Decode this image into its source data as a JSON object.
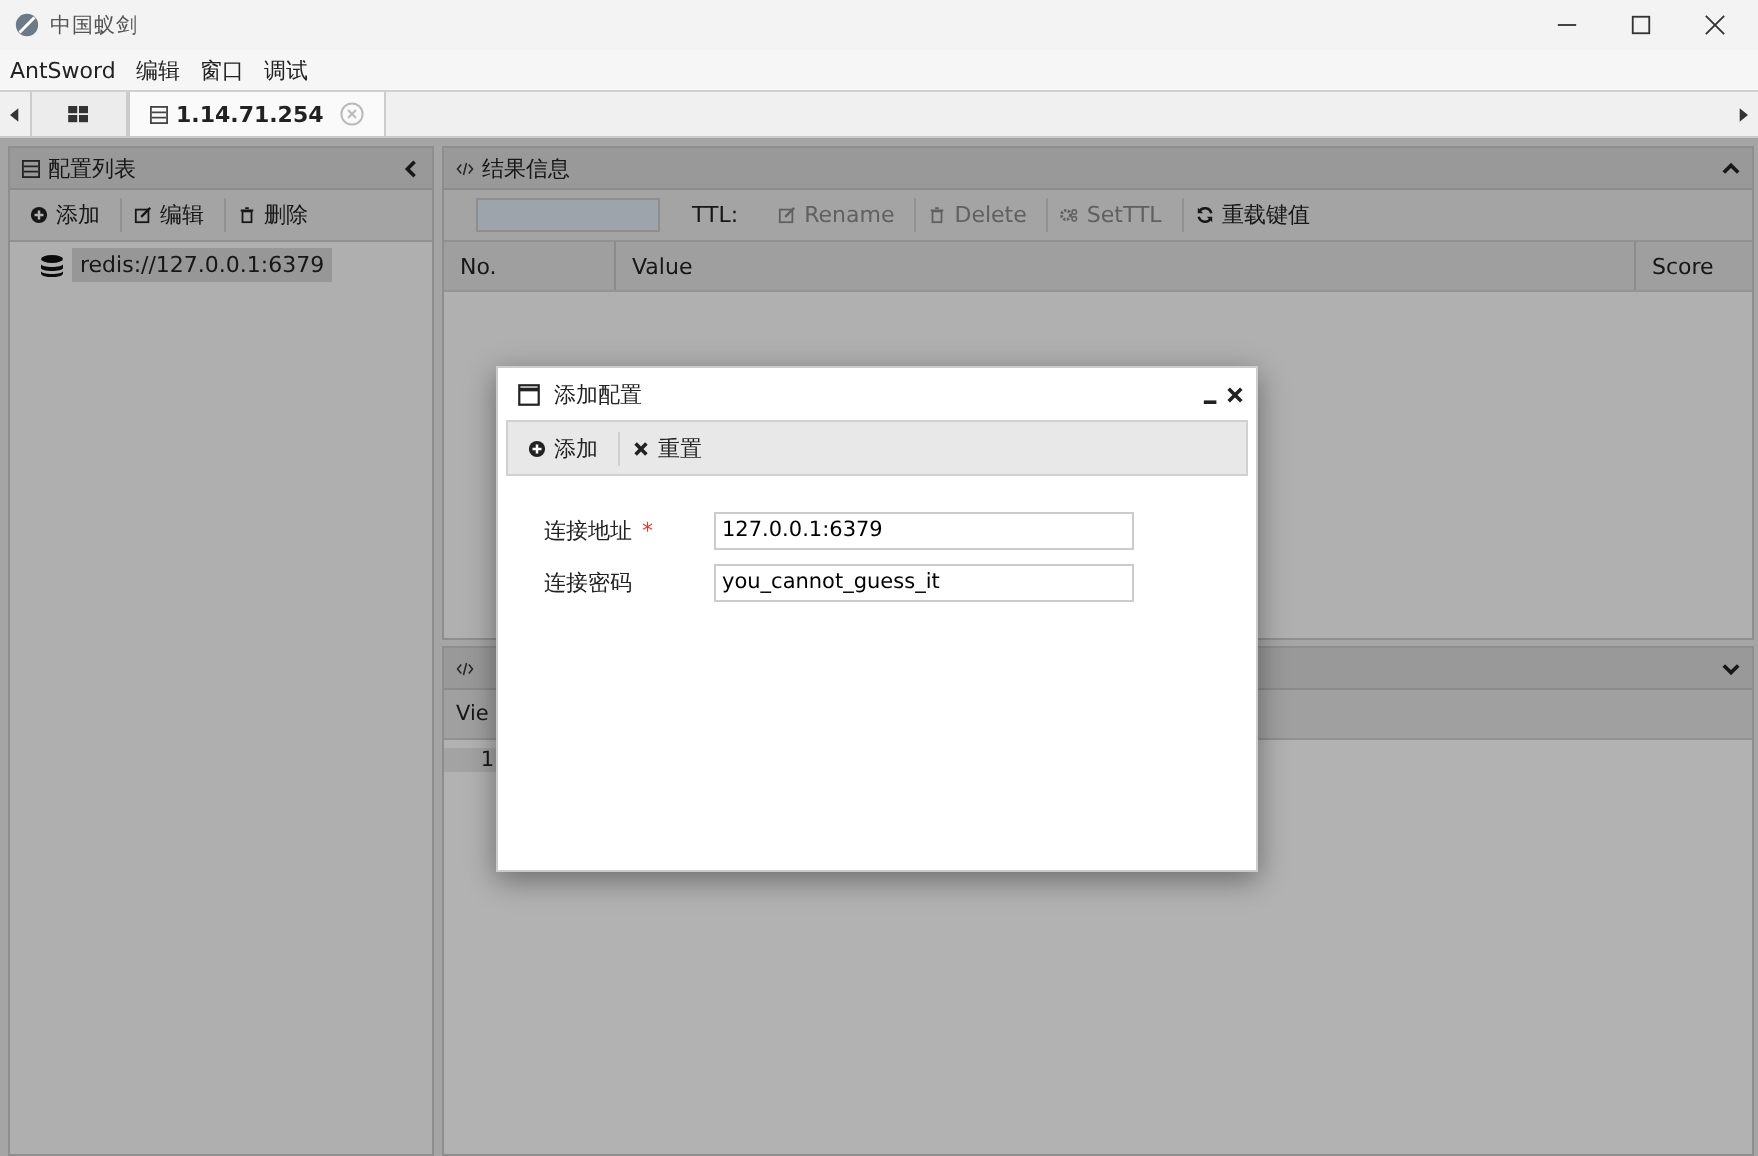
{
  "window": {
    "title": "中国蚁剑"
  },
  "menu": [
    "AntSword",
    "编辑",
    "窗口",
    "调试"
  ],
  "tabs": [
    {
      "kind": "home",
      "selected": false
    },
    {
      "kind": "server",
      "label": "1.14.71.254",
      "selected": true
    }
  ],
  "config_panel": {
    "title": "配置列表",
    "toolbar": [
      {
        "kind": "add",
        "label": "添加"
      },
      {
        "kind": "edit",
        "label": "编辑"
      },
      {
        "kind": "delete",
        "label": "删除"
      }
    ],
    "items": [
      {
        "label": "redis://127.0.0.1:6379",
        "selected": true
      }
    ]
  },
  "result_panel": {
    "title": "结果信息",
    "ttl_label": "TTL:",
    "toolbar": [
      {
        "kind": "edit",
        "label": "Rename",
        "disabled": true
      },
      {
        "kind": "delete",
        "label": "Delete",
        "disabled": true
      },
      {
        "kind": "gears",
        "label": "SetTTL",
        "disabled": true
      },
      {
        "kind": "reload",
        "label": "重载键值",
        "disabled": false
      }
    ],
    "columns": [
      "No.",
      "Value",
      "Score"
    ]
  },
  "detail_panel": {
    "columns": [
      "Vie"
    ],
    "line_numbers": [
      "1"
    ]
  },
  "dialog": {
    "title": "添加配置",
    "toolbar": [
      {
        "kind": "add",
        "label": "添加"
      },
      {
        "kind": "close",
        "label": "重置"
      }
    ],
    "fields": [
      {
        "label": "连接地址",
        "required_mark": "*",
        "value": "127.0.0.1:6379"
      },
      {
        "label": "连接密码",
        "value": "you_cannot_guess_it"
      }
    ]
  }
}
